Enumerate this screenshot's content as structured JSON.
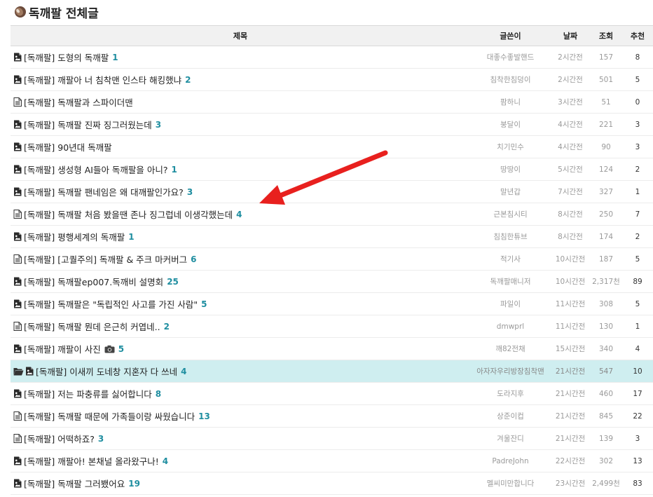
{
  "header": {
    "title": "독깨팔 전체글"
  },
  "table": {
    "columns": {
      "title": "제목",
      "writer": "글쓴이",
      "date": "날짜",
      "views": "조회",
      "votes": "추천"
    },
    "rows": [
      {
        "icon": "image-post-icon",
        "prefix": "[독깨팔]",
        "title": "도형의 독깨팔",
        "comments": "1",
        "writer": "대좋수좋발핸드",
        "date": "2시간전",
        "views": "157",
        "votes": "8"
      },
      {
        "icon": "image-post-icon",
        "prefix": "[독깨팔]",
        "title": "깨팔아 너 침착맨 인스타 해킹했냐",
        "comments": "2",
        "writer": "침착한침덩이",
        "date": "2시간전",
        "views": "501",
        "votes": "5"
      },
      {
        "icon": "text-post-icon",
        "prefix": "[독깨팔]",
        "title": "독깨팔과 스파이더맨",
        "comments": "",
        "writer": "팜하니",
        "date": "3시간전",
        "views": "51",
        "votes": "0"
      },
      {
        "icon": "image-post-icon",
        "prefix": "[독깨팔]",
        "title": "독깨팔 진짜 징그러웠는데",
        "comments": "3",
        "writer": "붕달이",
        "date": "4시간전",
        "views": "221",
        "votes": "3"
      },
      {
        "icon": "image-post-icon",
        "prefix": "[독깨팔]",
        "title": "90년대 독깨팔",
        "comments": "",
        "writer": "치기민수",
        "date": "4시간전",
        "views": "90",
        "votes": "3"
      },
      {
        "icon": "image-post-icon",
        "prefix": "[독깨팔]",
        "title": "생성형 AI들아 독깨팔을 아니?",
        "comments": "1",
        "writer": "땅땅이",
        "date": "5시간전",
        "views": "124",
        "votes": "2"
      },
      {
        "icon": "image-post-icon",
        "prefix": "[독깨팔]",
        "title": "독깨팔 팬네임은 왜 대깨팔인가요?",
        "comments": "3",
        "writer": "말년갑",
        "date": "7시간전",
        "views": "327",
        "votes": "1"
      },
      {
        "icon": "text-post-icon",
        "prefix": "[독깨팔]",
        "title": "독깨팔 처음 봤을땐 존나 징그럽네 이생각했는데",
        "comments": "4",
        "writer": "근본침시티",
        "date": "8시간전",
        "views": "250",
        "votes": "7"
      },
      {
        "icon": "image-post-icon",
        "prefix": "[독깨팔]",
        "title": "평행세계의 독깨팔",
        "comments": "1",
        "writer": "침침한튜브",
        "date": "8시간전",
        "views": "174",
        "votes": "2"
      },
      {
        "icon": "text-post-icon",
        "prefix": "[독깨팔]",
        "title": "[고퀄주의] 독깨팔 & 주크 마커버그",
        "comments": "6",
        "writer": "적기사",
        "date": "10시간전",
        "views": "187",
        "votes": "5"
      },
      {
        "icon": "image-post-icon",
        "prefix": "[독깨팔]",
        "title": "독깨팔ep007.독깨비 설명회",
        "comments": "25",
        "writer": "독깨팔매니저",
        "date": "10시간전",
        "views": "2,317천",
        "votes": "89"
      },
      {
        "icon": "image-post-icon",
        "prefix": "[독깨팔]",
        "title": "독깨팔은 \"독립적인 사고를 가진 사람\"",
        "comments": "5",
        "writer": "파일이",
        "date": "11시간전",
        "views": "308",
        "votes": "5"
      },
      {
        "icon": "text-post-icon",
        "prefix": "[독깨팔]",
        "title": "독깨팔 뭔데 은근히 커엽네..",
        "comments": "2",
        "writer": "dmwprl",
        "date": "11시간전",
        "views": "130",
        "votes": "1"
      },
      {
        "icon": "image-post-icon",
        "prefix": "[독깨팔]",
        "title": "깨팔이 사진",
        "camera": true,
        "comments": "5",
        "writer": "깨82전채",
        "date": "15시간전",
        "views": "340",
        "votes": "4"
      },
      {
        "icon": "image-post-icon",
        "folder": true,
        "highlight": true,
        "prefix": "[독깨팔]",
        "title": "이새끼 도네창 지혼자 다 쓰네",
        "comments": "4",
        "writer": "아자자우리방장침착맨",
        "date": "21시간전",
        "views": "547",
        "votes": "10"
      },
      {
        "icon": "image-post-icon",
        "prefix": "[독깨팔]",
        "title": "저는 파충류를 싫어합니다",
        "comments": "8",
        "writer": "도라지후",
        "date": "21시간전",
        "views": "460",
        "votes": "17"
      },
      {
        "icon": "text-post-icon",
        "prefix": "[독깨팔]",
        "title": "독깨팔 때문에 가족들이랑 싸웠습니다",
        "comments": "13",
        "writer": "상준이컵",
        "date": "21시간전",
        "views": "845",
        "votes": "22"
      },
      {
        "icon": "text-post-icon",
        "prefix": "[독깨팔]",
        "title": "어떡하죠?",
        "comments": "3",
        "writer": "겨울잔디",
        "date": "21시간전",
        "views": "139",
        "votes": "3"
      },
      {
        "icon": "image-post-icon",
        "prefix": "[독깨팔]",
        "title": "깨팔아! 본채널 올라왔구나!",
        "comments": "4",
        "writer": "PadreJohn",
        "date": "22시간전",
        "views": "302",
        "votes": "13"
      },
      {
        "icon": "image-post-icon",
        "prefix": "[독깨팔]",
        "title": "독깨팔 그러뵀어요",
        "comments": "19",
        "writer": "멜씨미만합니다",
        "date": "23시간전",
        "views": "2,499천",
        "votes": "83"
      }
    ]
  },
  "annotation": {
    "arrow_color": "#e8201e"
  }
}
